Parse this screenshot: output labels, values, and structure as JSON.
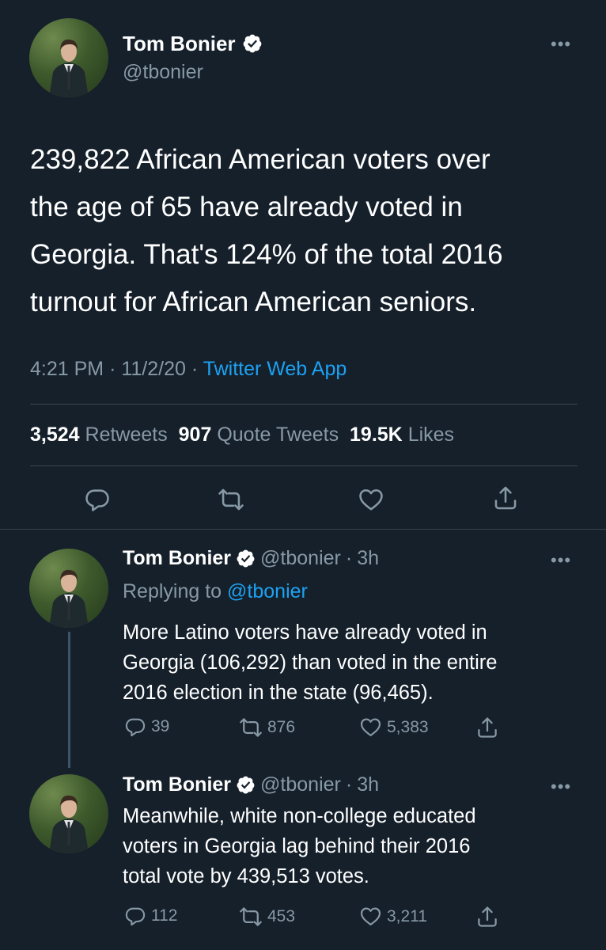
{
  "main": {
    "author_name": "Tom Bonier",
    "author_handle": "@tbonier",
    "text_lines": [
      "239,822 African American voters over",
      "the age of 65 have already voted in",
      "Georgia. That's 124% of the total 2016",
      "turnout for African American seniors."
    ],
    "time": "4:21 PM",
    "date": "11/2/20",
    "source": "Twitter Web App",
    "sep": "·",
    "retweets_count": "3,524",
    "retweets_label": "Retweets",
    "quotes_count": "907",
    "quotes_label": "Quote Tweets",
    "likes_count": "19.5K",
    "likes_label": "Likes"
  },
  "replies": [
    {
      "author_name": "Tom Bonier",
      "author_handle": "@tbonier",
      "age": "3h",
      "replying_prefix": "Replying to",
      "replying_handle": "@tbonier",
      "text_lines": [
        "More Latino voters have already voted in",
        "Georgia (106,292) than voted in the entire",
        "2016 election in the state (96,465)."
      ],
      "replies": "39",
      "retweets": "876",
      "likes": "5,383"
    },
    {
      "author_name": "Tom Bonier",
      "author_handle": "@tbonier",
      "age": "3h",
      "text_lines": [
        "Meanwhile, white non-college educated",
        "voters in Georgia lag behind their 2016",
        "total vote by 439,513 votes."
      ],
      "replies": "112",
      "retweets": "453",
      "likes": "3,211"
    }
  ],
  "icons": {
    "verified": "verified-badge-icon",
    "more": "more-horizontal-icon",
    "reply": "reply-icon",
    "retweet": "retweet-icon",
    "like": "heart-icon",
    "share": "share-icon"
  },
  "colors": {
    "background": "#15202b",
    "accent": "#1da1f2",
    "muted": "#8899a6",
    "divider": "#38444d"
  }
}
